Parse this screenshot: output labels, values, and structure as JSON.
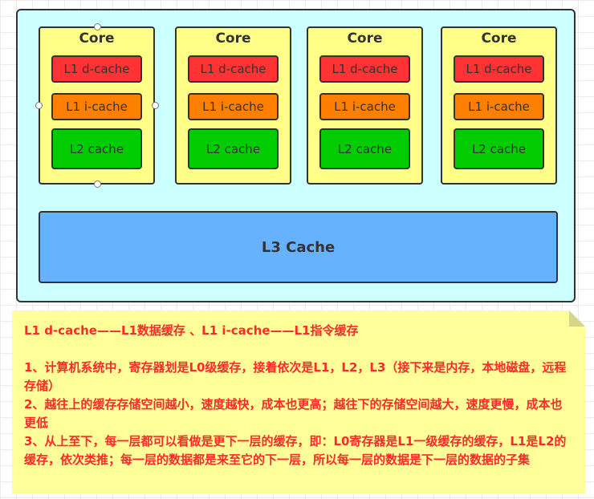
{
  "diagram": {
    "cores": [
      {
        "title": "Core",
        "l1d": "L1 d-cache",
        "l1i": "L1 i-cache",
        "l2": "L2 cache"
      },
      {
        "title": "Core",
        "l1d": "L1 d-cache",
        "l1i": "L1 i-cache",
        "l2": "L2 cache"
      },
      {
        "title": "Core",
        "l1d": "L1 d-cache",
        "l1i": "L1 i-cache",
        "l2": "L2 cache"
      },
      {
        "title": "Core",
        "l1d": "L1 d-cache",
        "l1i": "L1 i-cache",
        "l2": "L2 cache"
      }
    ],
    "l3": "L3 Cache"
  },
  "note": {
    "heading": "L1 d-cache——L1数据缓存 、L1 i-cache——L1指令缓存",
    "items": [
      "1、计算机系统中，寄存器划是L0级缓存，接着依次是L1，L2，L3（接下来是内存，本地磁盘，远程存储）",
      "2、越往上的缓存存储空间越小，速度越快，成本也更高；越往下的存储空间越大，速度更慢，成本也更低",
      "3、从上至下，每一层都可以看做是更下一层的缓存，即：L0寄存器是L1一级缓存的缓存，L1是L2的缓存，依次类推；每一层的数据都是来至它的下一层，所以每一层的数据是下一层的数据的子集"
    ]
  },
  "colors": {
    "outer_bg": "#ccffff",
    "core_bg": "#ffff88",
    "l1d": "#ff3333",
    "l1i": "#ff8000",
    "l2": "#00cc00",
    "l3": "#66b2ff",
    "note_bg": "#ffff99",
    "note_text": "#ff2a2a"
  }
}
